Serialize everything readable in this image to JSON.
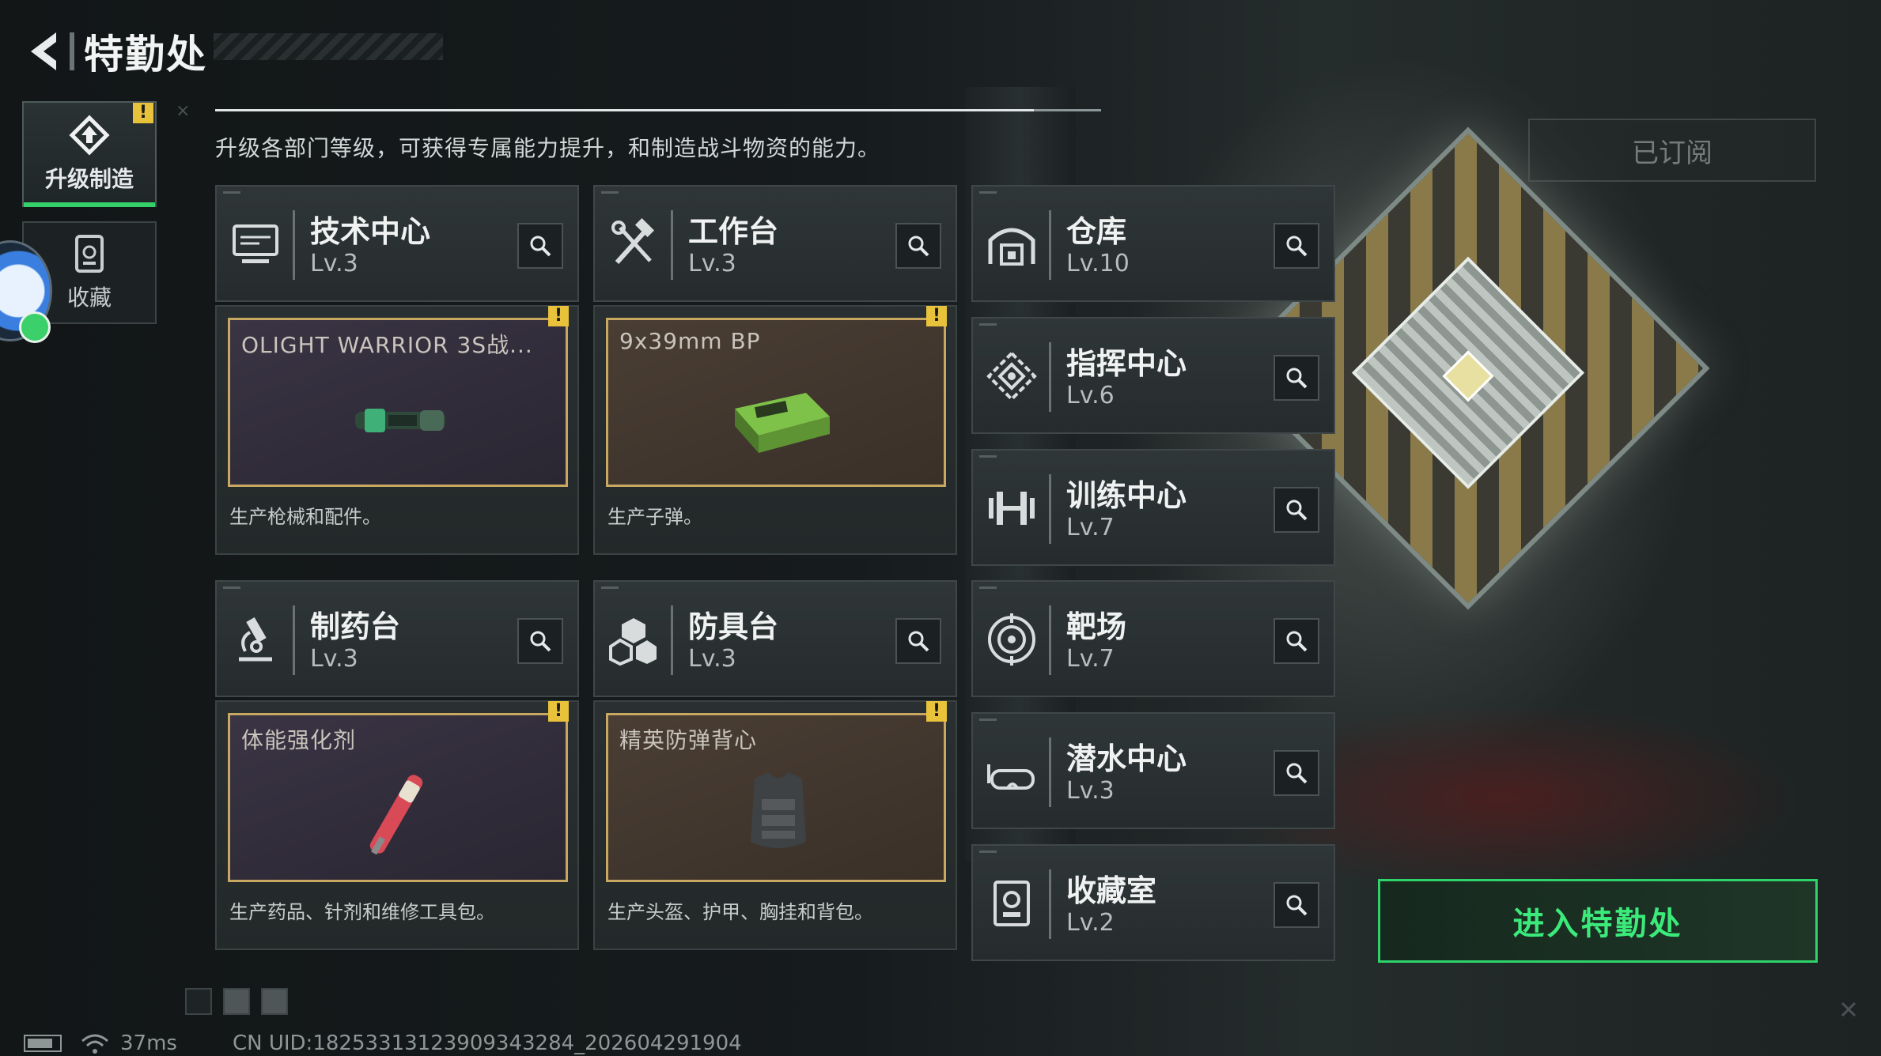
{
  "header": {
    "title": "特勤处"
  },
  "side_tabs": [
    {
      "label": "升级制造",
      "icon": "upgrade-icon",
      "active": true,
      "badge": "!"
    },
    {
      "label": "收藏",
      "icon": "collection-icon",
      "active": false
    }
  ],
  "description": "升级各部门等级，可获得专属能力提升，和制造战斗物资的能力。",
  "subscribed_label": "已订阅",
  "departments": [
    {
      "name": "技术中心",
      "level": "Lv.3",
      "icon": "monitor-icon"
    },
    {
      "name": "工作台",
      "level": "Lv.3",
      "icon": "tools-icon"
    },
    {
      "name": "仓库",
      "level": "Lv.10",
      "icon": "warehouse-icon"
    },
    {
      "name": "指挥中心",
      "level": "Lv.6",
      "icon": "command-icon"
    },
    {
      "name": "训练中心",
      "level": "Lv.7",
      "icon": "dumbbell-icon"
    },
    {
      "name": "制药台",
      "level": "Lv.3",
      "icon": "microscope-icon"
    },
    {
      "name": "防具台",
      "level": "Lv.3",
      "icon": "armor-icon"
    },
    {
      "name": "靶场",
      "level": "Lv.7",
      "icon": "target-icon"
    },
    {
      "name": "潜水中心",
      "level": "Lv.3",
      "icon": "diving-mask-icon"
    },
    {
      "name": "收藏室",
      "level": "Lv.2",
      "icon": "collection-room-icon"
    }
  ],
  "crafting": [
    {
      "item": "OLIGHT WARRIOR 3S战...",
      "desc": "生产枪械和配件。",
      "badge": "!"
    },
    {
      "item": "9x39mm BP",
      "desc": "生产子弹。",
      "badge": "!"
    },
    {
      "item": "体能强化剂",
      "desc": "生产药品、针剂和维修工具包。",
      "badge": "!"
    },
    {
      "item": "精英防弹背心",
      "desc": "生产头盔、护甲、胸挂和背包。",
      "badge": "!"
    }
  ],
  "enter_button": "进入特勤处",
  "status": {
    "ping": "37ms",
    "uid": "CN UID:18253313123909343284_202604291904"
  },
  "colors": {
    "accent_green": "#3bea7a",
    "warning_yellow": "#e8c23a",
    "slot_border": "#c8a860"
  }
}
